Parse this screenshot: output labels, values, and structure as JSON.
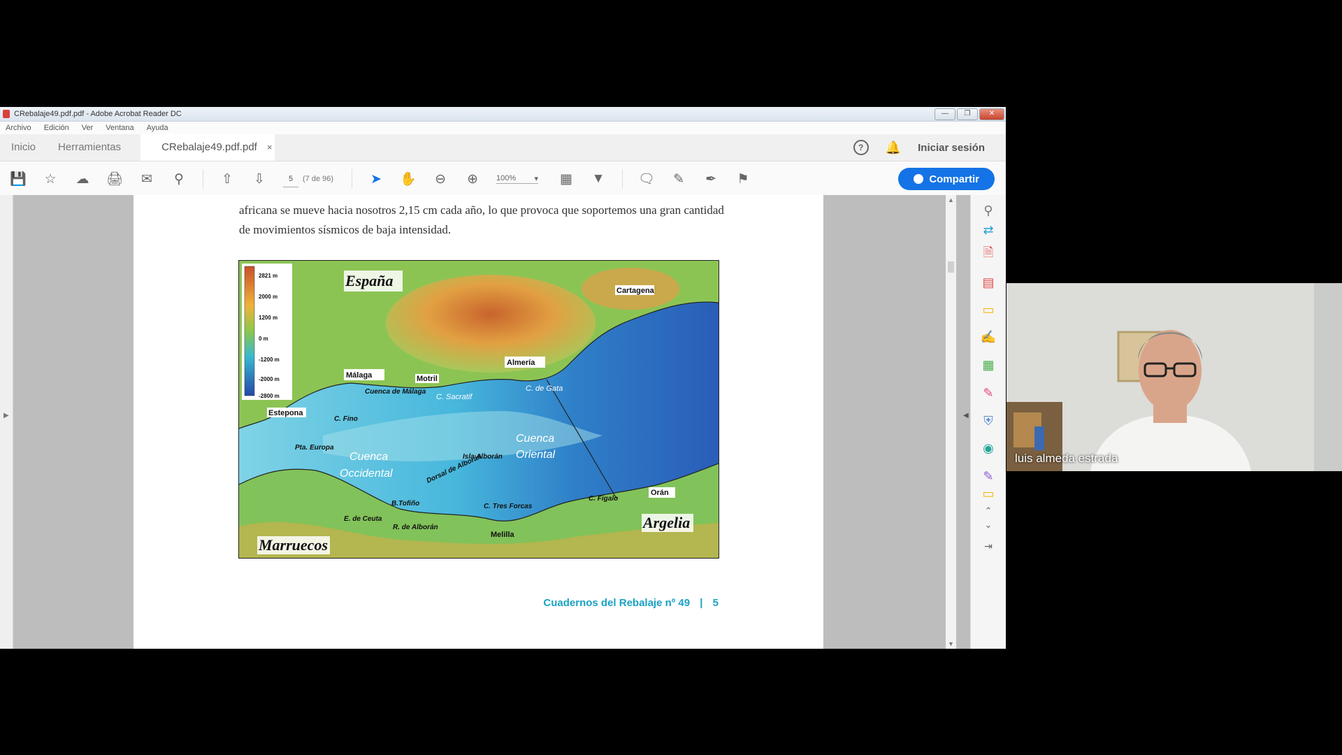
{
  "window": {
    "title": "CRebalaje49.pdf.pdf - Adobe Acrobat Reader DC",
    "controls": [
      "—",
      "❐",
      "✕"
    ]
  },
  "menu": [
    "Archivo",
    "Edición",
    "Ver",
    "Ventana",
    "Ayuda"
  ],
  "tabs": {
    "home": "Inicio",
    "tools": "Herramientas",
    "doc": "CRebalaje49.pdf.pdf",
    "close": "×",
    "signin": "Iniciar sesión",
    "help": "?"
  },
  "toolbar": {
    "page_current": "5",
    "page_of": "(7 de 96)",
    "zoom": "100%",
    "share": "Compartir"
  },
  "document": {
    "paragraph": "africana se mueve hacia nosotros 2,15 cm cada año, lo que provoca que soportemos una gran cantidad de movimientos sísmicos de baja intensidad.",
    "footer_title": "Cuadernos del Rebalaje nº 49",
    "footer_sep": "|",
    "footer_page": "5",
    "map": {
      "legend": [
        "2821 m",
        "2000 m",
        "1200 m",
        "0 m",
        "-1200 m",
        "-2000 m",
        "-2800 m"
      ],
      "countries": {
        "spain": "España",
        "morocco": "Marruecos",
        "algeria": "Argelia"
      },
      "cities": {
        "malaga": "Málaga",
        "almeria": "Almería",
        "cartagena": "Cartagena",
        "estepona": "Estepona",
        "motril": "Motril",
        "oran": "Orán",
        "melilla": "Melilla"
      },
      "basins": {
        "west": [
          "Cuenca",
          "Occidental"
        ],
        "east": [
          "Cuenca",
          "Oriental"
        ]
      },
      "features": {
        "c_sacratif": "C. Sacratif",
        "c_gata": "C. de Gata",
        "c_fino": "C. Fino",
        "pta_europa": "Pta. Europa",
        "b_tofino": "B.Tofiño",
        "c_tres_forcas": "C. Tres Forcas",
        "c_figalo": "C. Figalo",
        "e_ceuta": "E. de Ceuta",
        "r_alboran": "R. de Alborán",
        "isla_alboran": "Isla Alborán",
        "dorsal_alboran": "Dorsal de Alborán",
        "cuenca_malaga": "Cuenca de Málaga"
      }
    }
  },
  "video": {
    "participant": "luis almeda estrada"
  }
}
